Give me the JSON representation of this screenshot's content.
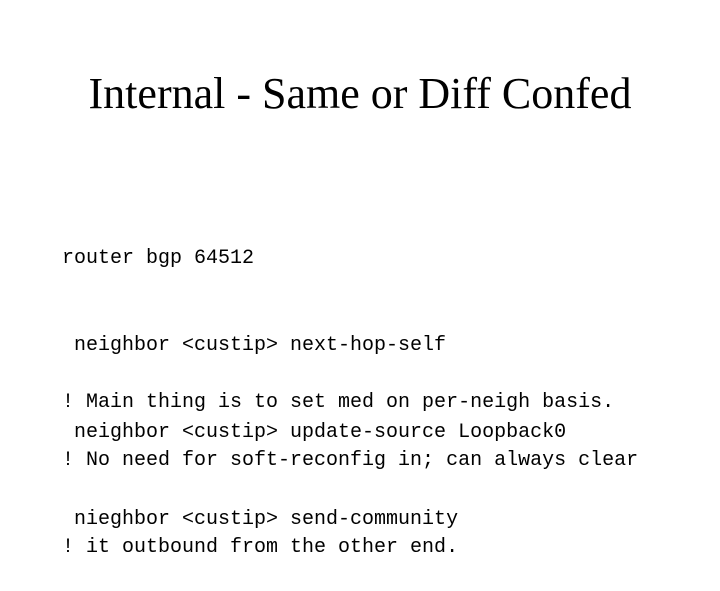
{
  "slide": {
    "title": "Internal - Same or Diff Confed",
    "config_block": [
      "router bgp 64512",
      " neighbor <custip> next-hop-self",
      " neighbor <custip> update-source Loopback0",
      " nieghbor <custip> send-community"
    ],
    "note_1": [
      "! Main thing is to set med on per-neigh basis."
    ],
    "note_2": [
      "! No need for soft-reconfig in; can always clear",
      "! it outbound from the other end."
    ]
  }
}
